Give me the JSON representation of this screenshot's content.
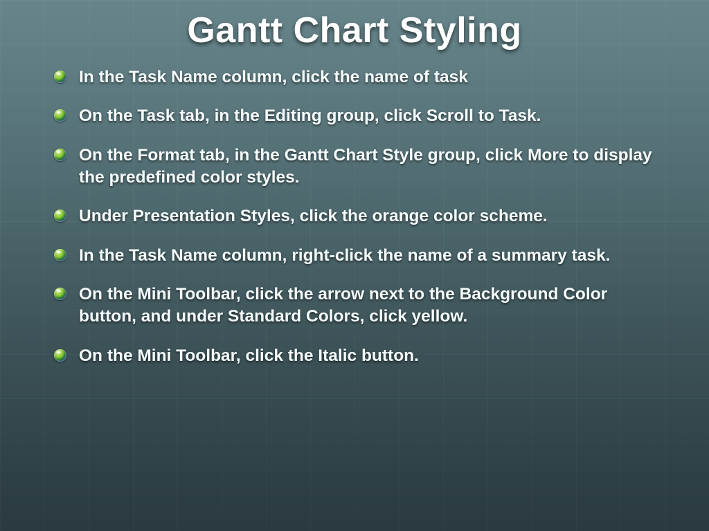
{
  "slide": {
    "title": "Gantt Chart Styling",
    "bullets": [
      "In the Task Name column, click the name of task",
      "On the Task tab, in the Editing group, click Scroll to Task.",
      "On the Format tab, in the Gantt Chart Style group, click More to display the predefined color styles.",
      "Under Presentation Styles, click the orange color scheme.",
      "In the Task Name column, right-click the name of a summary task.",
      " On the Mini Toolbar, click the arrow next to the Background Color button, and under Standard Colors, click yellow.",
      "On the Mini Toolbar, click the Italic button."
    ]
  }
}
